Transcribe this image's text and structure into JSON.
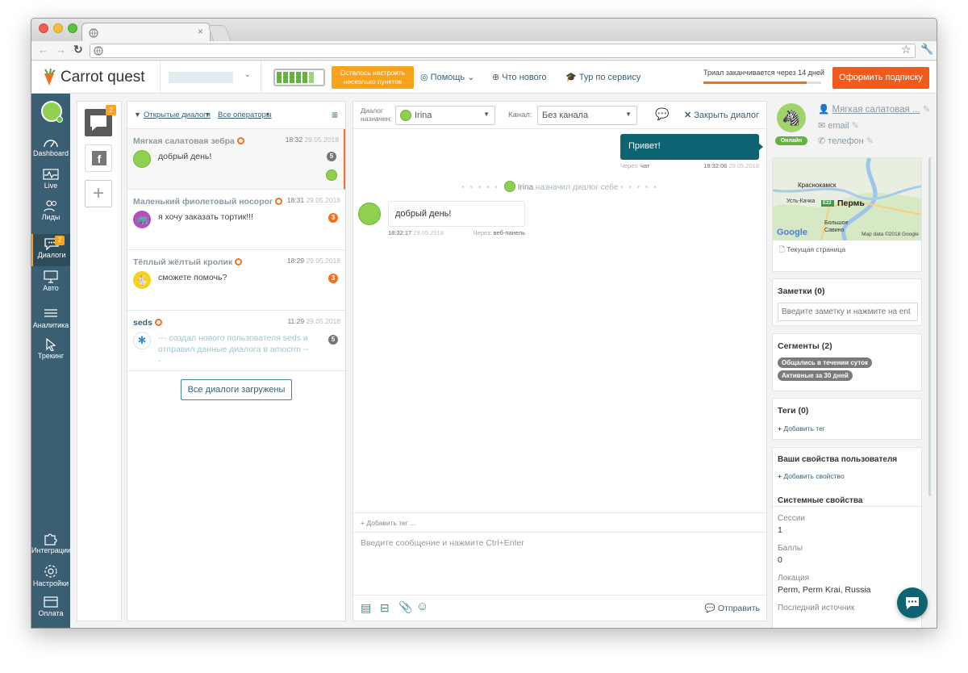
{
  "app": {
    "brand": "Carrot quest",
    "setup_notice": "Осталось настроить несколько пунктов",
    "help": "Помощь",
    "whats_new": "Что нового",
    "tour": "Тур по сервису",
    "trial": "Триал заканчивается через 14 дней",
    "subscribe": "Оформить подписку",
    "trial_progress": 0.88
  },
  "nav": {
    "items": [
      {
        "label": "Dashboard",
        "icon": "gauge-icon"
      },
      {
        "label": "Live",
        "icon": "pulse-icon"
      },
      {
        "label": "Лиды",
        "icon": "users-icon"
      },
      {
        "label": "Диалоги",
        "icon": "chat-icon",
        "badge": "2"
      },
      {
        "label": "Авто",
        "icon": "monitor-icon"
      },
      {
        "label": "Аналитика",
        "icon": "bars-icon"
      },
      {
        "label": "Трекинг",
        "icon": "cursor-icon"
      }
    ],
    "bottom": [
      {
        "label": "Интеграции",
        "icon": "puzzle-icon"
      },
      {
        "label": "Настройки",
        "icon": "gear-icon"
      },
      {
        "label": "Оплата",
        "icon": "card-icon"
      }
    ]
  },
  "channels": {
    "chat_badge": "2"
  },
  "dialogs": {
    "filter_open": "Открытые диалоги",
    "filter_ops": "Все операторы",
    "loaded": "Все диалоги загружены",
    "items": [
      {
        "name": "Мягкая салатовая зебра",
        "time": "18:32",
        "date": "29.05.2018",
        "text": "добрый день!",
        "count": "5"
      },
      {
        "name": "Маленький фиолетовый носорог",
        "time": "18:31",
        "date": "29.05.2018",
        "text": "я хочу заказать тортик!!!",
        "count": "3"
      },
      {
        "name": "Тёплый жёлтый кролик",
        "time": "18:29",
        "date": "29.05.2018",
        "text": "сможете помочь?",
        "count": "3"
      },
      {
        "name": "seds",
        "time": "11:29",
        "date": "29.05.2018",
        "text": "--- создал нового пользователя seds и отправил данные диалога в amocrm ---",
        "count": "5"
      }
    ]
  },
  "chat": {
    "assigned_label": "Диалог назначен:",
    "assignee": "Irina",
    "channel_label": "Канал:",
    "channel": "Без канала",
    "close": "Закрыть диалог",
    "out_msg": "Привет!",
    "out_via_label": "Через:",
    "out_via": "чат",
    "out_time": "18:32:06",
    "out_date": "29.05.2018",
    "system_name": "Irina",
    "system_text": "назначил диалог себе",
    "in_msg": "добрый день!",
    "in_time": "18:32:17",
    "in_date": "29.05.2018",
    "in_via_label": "Через:",
    "in_via": "веб-панель",
    "add_tag": "+ Добавить тег ...",
    "input_placeholder": "Введите сообщение и нажмите Ctrl+Enter",
    "send": "Отправить"
  },
  "user": {
    "name": "Мягкая салатовая ...",
    "status": "Онлайн",
    "email": "email",
    "phone": "телефон",
    "map_city1": "Краснокамск",
    "map_city2": "Пермь",
    "map_city3": "Усть-Качка",
    "map_city4": "Большое Савино",
    "map_road": "E22",
    "map_brand": "Google",
    "map_credit": "Map data ©2018 Google",
    "current_page": "Текущая страница",
    "notes_title": "Заметки (0)",
    "notes_placeholder": "Введите заметку и нажмите на ent",
    "segments_title": "Сегменты (2)",
    "segments": [
      "Общались в течении суток",
      "Активные за 30 дней"
    ],
    "tags_title": "Теги (0)",
    "add_tag": "Добавить тег",
    "props_title": "Ваши свойства пользователя",
    "add_prop": "Добавить свойство",
    "sys_title": "Системные свойства",
    "props": [
      {
        "label": "Сессии",
        "value": "1"
      },
      {
        "label": "Баллы",
        "value": "0"
      },
      {
        "label": "Локация",
        "value": "Perm, Perm Krai, Russia"
      },
      {
        "label": "Последний источник",
        "value": ""
      }
    ]
  },
  "colors": {
    "nav": "#3a5f72",
    "accent": "#f2701e",
    "teal": "#0e6372",
    "green": "#8fd14f"
  }
}
